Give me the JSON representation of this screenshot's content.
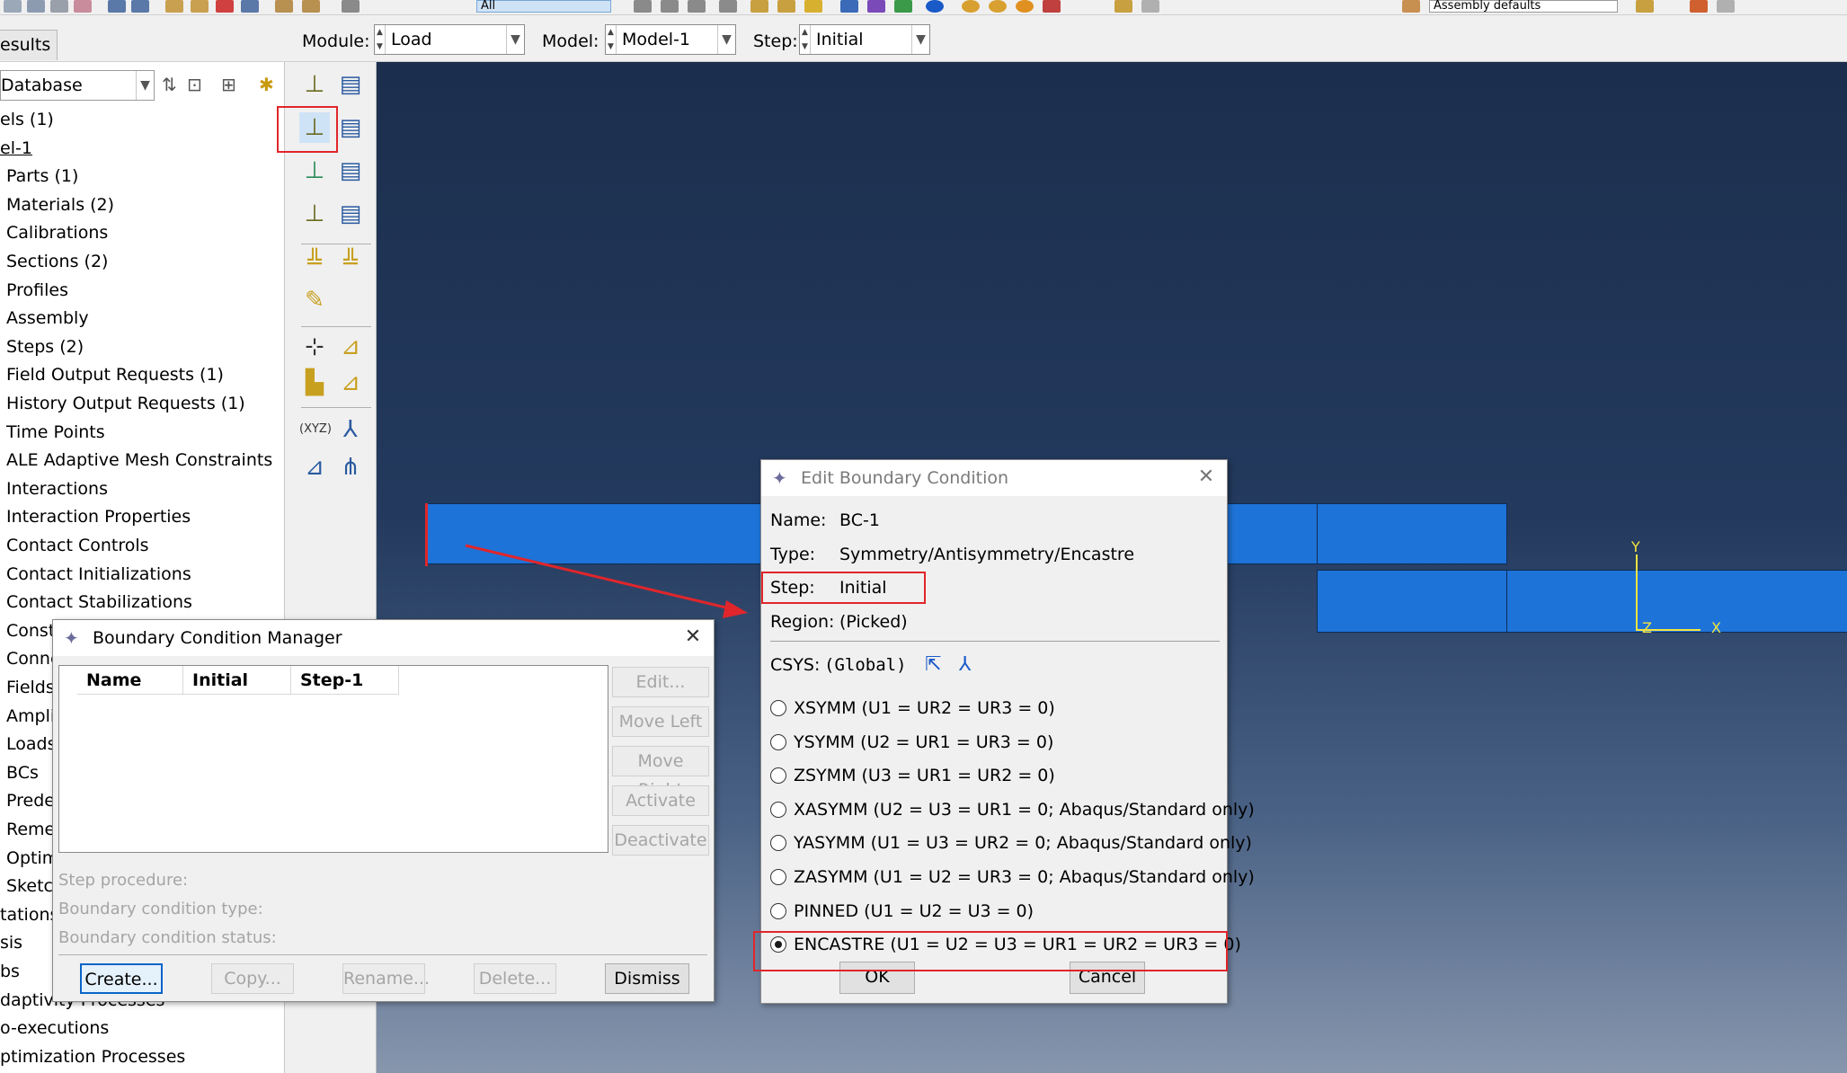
{
  "toolbar": {
    "search_value": "All",
    "render_style": "Assembly defaults"
  },
  "context": {
    "results_tab": "esults",
    "module_label": "Module:",
    "module_value": "Load",
    "model_label": "Model:",
    "model_value": "Model-1",
    "step_label": "Step:",
    "step_value": "Initial"
  },
  "tree": {
    "db_value": "Database",
    "items": [
      "els (1)",
      "el-1",
      "Parts (1)",
      "Materials (2)",
      "Calibrations",
      "Sections (2)",
      "Profiles",
      "Assembly",
      "Steps (2)",
      "Field Output Requests (1)",
      "History Output Requests (1)",
      "Time Points",
      "ALE Adaptive Mesh Constraints",
      "Interactions",
      "Interaction Properties",
      "Contact Controls",
      "Contact Initializations",
      "Contact Stabilizations",
      "Const",
      "Conne",
      "Fields",
      "Ampli",
      "Loads",
      "BCs",
      "Prede",
      "Reme",
      "Optim",
      "Sketcl",
      "tations",
      "sis",
      "bs",
      "daptivity Processes",
      "o-executions",
      "ptimization Processes"
    ]
  },
  "viewport": {
    "axis_y": "Y",
    "axis_x": "X",
    "axis_z": "Z"
  },
  "bc_manager": {
    "title": "Boundary Condition Manager",
    "col_name": "Name",
    "col_initial": "Initial",
    "col_step1": "Step-1",
    "btn_edit": "Edit...",
    "btn_move_left": "Move Left",
    "btn_move_right": "Move Right",
    "btn_activate": "Activate",
    "btn_deactivate": "Deactivate",
    "step_procedure": "Step procedure:",
    "bc_type": "Boundary condition type:",
    "bc_status": "Boundary condition status:",
    "btn_create": "Create...",
    "btn_copy": "Copy...",
    "btn_rename": "Rename...",
    "btn_delete": "Delete...",
    "btn_dismiss": "Dismiss"
  },
  "edit_bc": {
    "title": "Edit Boundary Condition",
    "name_label": "Name:",
    "name_value": "BC-1",
    "type_label": "Type:",
    "type_value": "Symmetry/Antisymmetry/Encastre",
    "step_label": "Step:",
    "step_value": "Initial",
    "region_label": "Region:",
    "region_value": "(Picked)",
    "csys_label": "CSYS:",
    "csys_value": "(Global)",
    "options": [
      "XSYMM (U1 = UR2 = UR3 = 0)",
      "YSYMM (U2 = UR1 = UR3 = 0)",
      "ZSYMM (U3 = UR1 = UR2 = 0)",
      "XASYMM (U2 = U3 = UR1 = 0; Abaqus/Standard only)",
      "YASYMM (U1 = U3 = UR2 = 0; Abaqus/Standard only)",
      "ZASYMM (U1 = U2 = UR3 = 0; Abaqus/Standard only)",
      "PINNED (U1 = U2 = U3 = 0)",
      "ENCASTRE (U1 = U2 = U3 = UR1 = UR2 = UR3 = 0)"
    ],
    "selected_option": "ENCASTRE",
    "btn_ok": "OK",
    "btn_cancel": "Cancel"
  },
  "colors": {
    "highlight": "#e0262b",
    "mesh": "#1e73d8",
    "axis": "#f4e340"
  }
}
